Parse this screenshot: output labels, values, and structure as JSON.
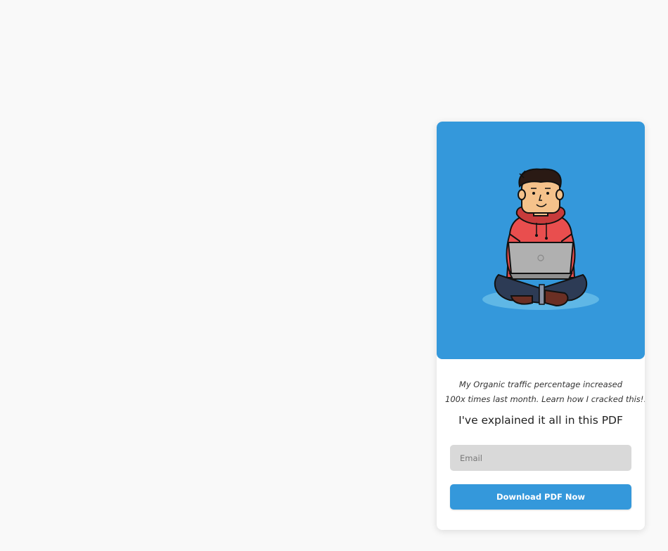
{
  "card": {
    "tagline_line1": "My Organic traffic percentage increased",
    "tagline_line2": "100x times last month. Learn how I cracked this!!",
    "headline": "I've explained it all in this PDF",
    "email_placeholder": "Email",
    "button_label": "Download PDF Now",
    "illustration": "person-with-laptop-illustration"
  },
  "colors": {
    "page_background": "#f9f9f9",
    "accent": "#3498db",
    "input_background": "#d9d9d9",
    "hoodie": "#e94e4e",
    "jeans": "#2d3b55"
  }
}
